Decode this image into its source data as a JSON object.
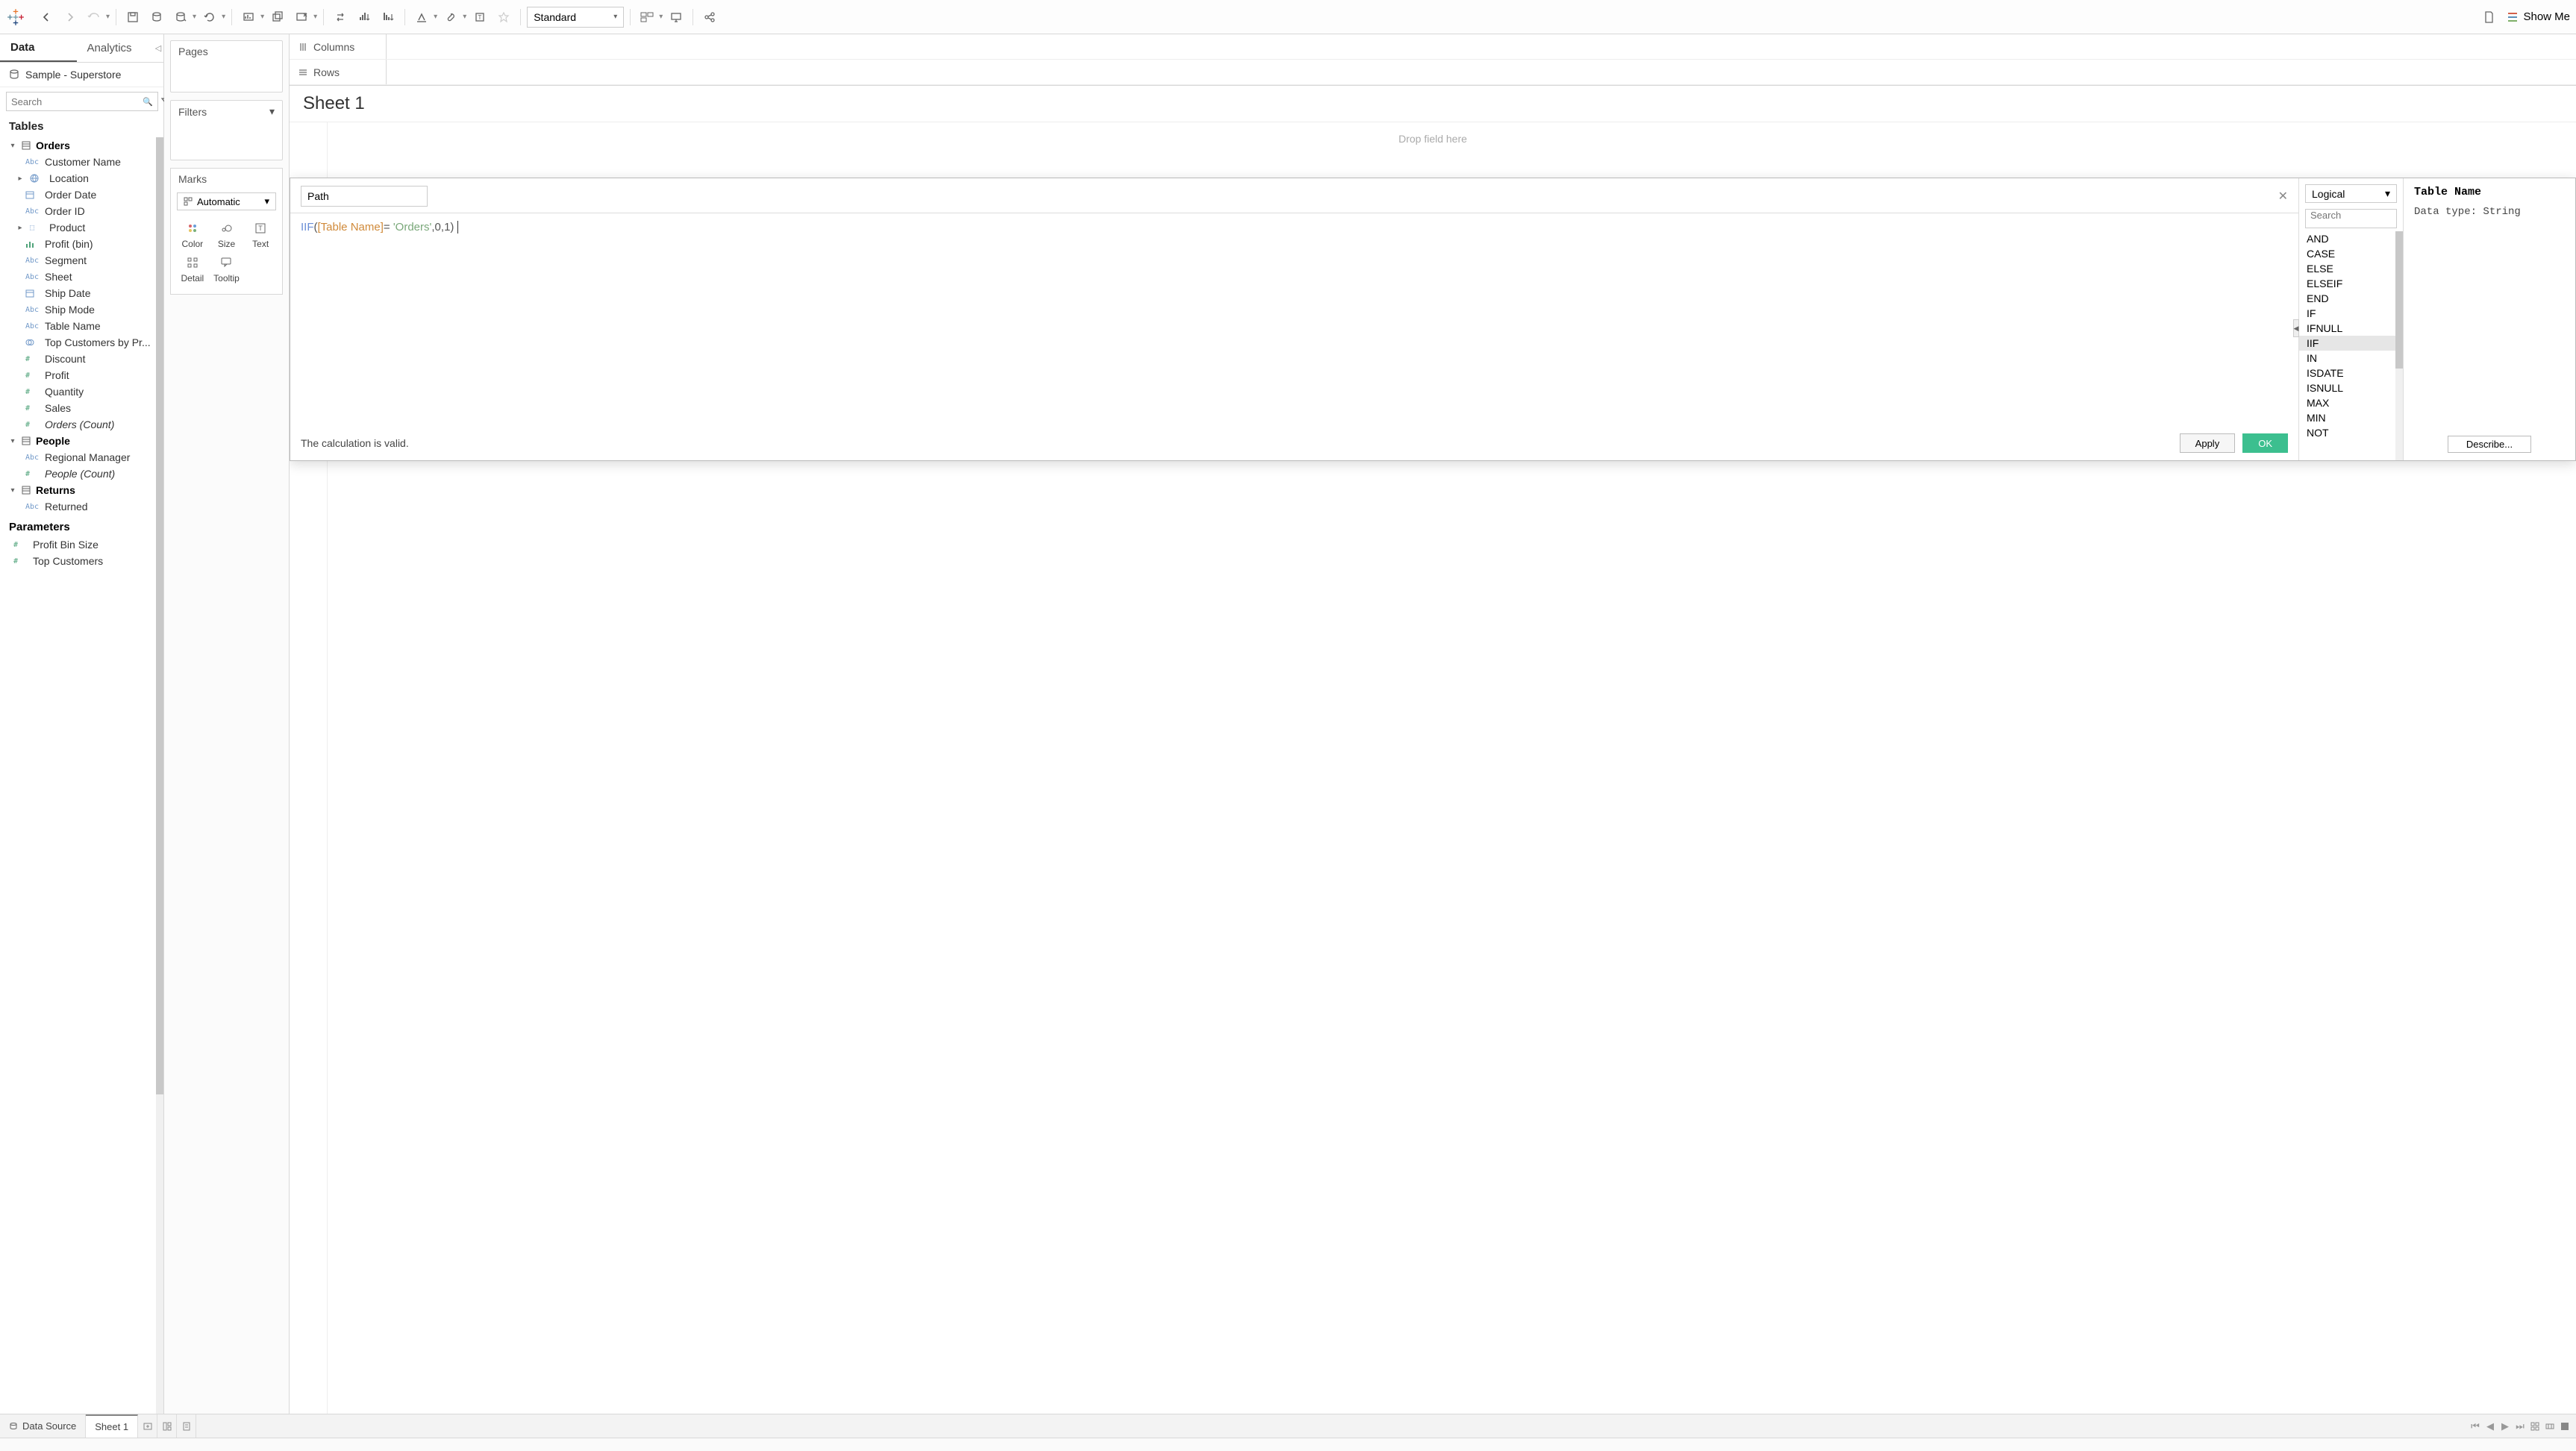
{
  "toolbar": {
    "fit_mode": "Standard",
    "show_me": "Show Me"
  },
  "sidebar": {
    "tabs": {
      "data": "Data",
      "analytics": "Analytics"
    },
    "datasource": "Sample - Superstore",
    "search_placeholder": "Search",
    "tables_label": "Tables",
    "parameters_label": "Parameters",
    "tables": [
      {
        "name": "Orders",
        "fields": [
          {
            "name": "Customer Name",
            "type": "Abc"
          },
          {
            "name": "Location",
            "type": "geo",
            "expandable": true
          },
          {
            "name": "Order Date",
            "type": "date"
          },
          {
            "name": "Order ID",
            "type": "Abc"
          },
          {
            "name": "Product",
            "type": "prod",
            "expandable": true
          },
          {
            "name": "Profit (bin)",
            "type": "bin"
          },
          {
            "name": "Segment",
            "type": "Abc"
          },
          {
            "name": "Sheet",
            "type": "Abc"
          },
          {
            "name": "Ship Date",
            "type": "date"
          },
          {
            "name": "Ship Mode",
            "type": "Abc"
          },
          {
            "name": "Table Name",
            "type": "Abc"
          },
          {
            "name": "Top Customers by Pr...",
            "type": "set"
          },
          {
            "name": "Discount",
            "type": "num"
          },
          {
            "name": "Profit",
            "type": "num"
          },
          {
            "name": "Quantity",
            "type": "num"
          },
          {
            "name": "Sales",
            "type": "num"
          },
          {
            "name": "Orders (Count)",
            "type": "num",
            "italic": true
          }
        ]
      },
      {
        "name": "People",
        "fields": [
          {
            "name": "Regional Manager",
            "type": "Abc"
          },
          {
            "name": "People (Count)",
            "type": "num",
            "italic": true
          }
        ]
      },
      {
        "name": "Returns",
        "fields": [
          {
            "name": "Returned",
            "type": "Abc"
          }
        ]
      }
    ],
    "parameters": [
      {
        "name": "Profit Bin Size",
        "type": "num"
      },
      {
        "name": "Top Customers",
        "type": "num"
      }
    ]
  },
  "mid": {
    "pages": "Pages",
    "filters": "Filters",
    "marks": "Marks",
    "marks_type": "Automatic",
    "cells": {
      "color": "Color",
      "size": "Size",
      "text": "Text",
      "detail": "Detail",
      "tooltip": "Tooltip"
    }
  },
  "shelves": {
    "columns": "Columns",
    "rows": "Rows"
  },
  "sheet": {
    "title": "Sheet 1",
    "drop_hint": "Drop field here"
  },
  "calc": {
    "name": "Path",
    "formula": {
      "func": "IIF",
      "field": "[Table Name]",
      "op": "= ",
      "string": "'Orders'",
      "tail": ",0,1)"
    },
    "valid": "The calculation is valid.",
    "apply": "Apply",
    "ok": "OK",
    "category": "Logical",
    "func_search_placeholder": "Search",
    "functions": [
      "AND",
      "CASE",
      "ELSE",
      "ELSEIF",
      "END",
      "IF",
      "IFNULL",
      "IIF",
      "IN",
      "ISDATE",
      "ISNULL",
      "MAX",
      "MIN",
      "NOT"
    ],
    "selected_function": "IIF",
    "help_title": "Table Name",
    "help_body": "Data type: String",
    "describe": "Describe..."
  },
  "bottom": {
    "data_source": "Data Source",
    "sheet": "Sheet 1"
  }
}
